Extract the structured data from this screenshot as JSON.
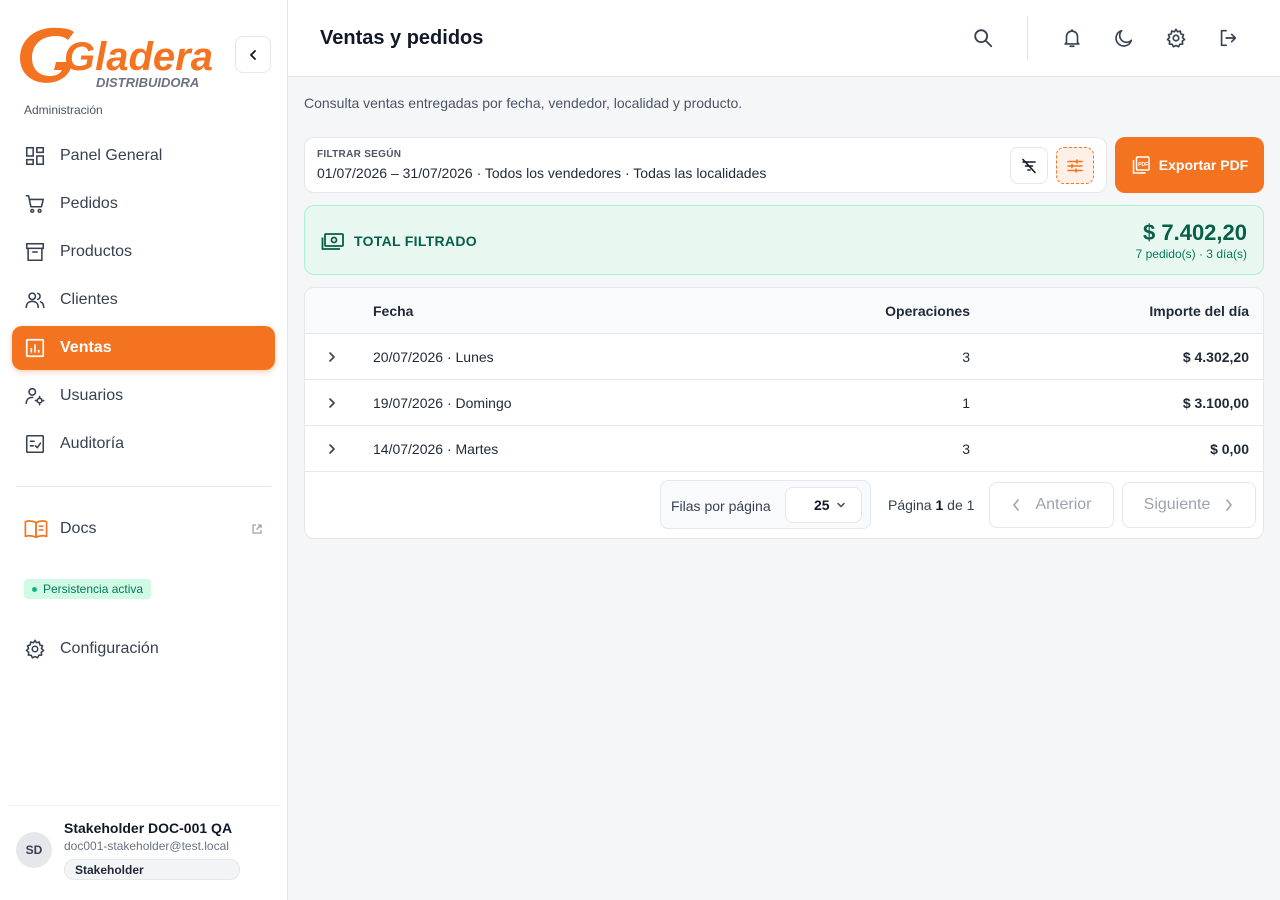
{
  "brand": {
    "name": "Gladera",
    "tagline": "DISTRIBUIDORA",
    "primary_color": "#f47320"
  },
  "sidebar": {
    "section_label": "Administración",
    "items": [
      {
        "label": "Panel General",
        "icon": "dashboard-icon"
      },
      {
        "label": "Pedidos",
        "icon": "cart-icon"
      },
      {
        "label": "Productos",
        "icon": "archive-box-icon"
      },
      {
        "label": "Clientes",
        "icon": "users-icon"
      },
      {
        "label": "Ventas",
        "icon": "chart-box-icon",
        "active": true
      },
      {
        "label": "Usuarios",
        "icon": "user-gear-icon"
      },
      {
        "label": "Auditoría",
        "icon": "checklist-icon"
      }
    ],
    "docs_label": "Docs",
    "persistence_badge": "Persistencia activa",
    "config_label": "Configuración",
    "user": {
      "initials": "SD",
      "name": "Stakeholder DOC-001 QA",
      "email": "doc001-stakeholder@test.local",
      "role": "Stakeholder"
    }
  },
  "header": {
    "title": "Ventas y pedidos",
    "icons": [
      "search-icon",
      "bell-icon",
      "moon-icon",
      "gear-icon",
      "logout-icon"
    ]
  },
  "main": {
    "subtitle": "Consulta ventas entregadas por fecha, vendedor, localidad y producto.",
    "filter": {
      "label": "FILTRAR SEGÚN",
      "value": "01/07/2026 – 31/07/2026 · Todos los vendedores · Todas las localidades"
    },
    "export_label": "Exportar PDF",
    "total": {
      "label": "TOTAL FILTRADO",
      "amount": "$ 7.402,20",
      "meta": "7 pedido(s) · 3 día(s)"
    },
    "table": {
      "columns": {
        "date": "Fecha",
        "ops": "Operaciones",
        "amount": "Importe del día"
      },
      "rows": [
        {
          "date": "20/07/2026 · Lunes",
          "ops": "3",
          "amount": "$ 4.302,20"
        },
        {
          "date": "19/07/2026 · Domingo",
          "ops": "1",
          "amount": "$ 3.100,00"
        },
        {
          "date": "14/07/2026 · Martes",
          "ops": "3",
          "amount": "$ 0,00"
        }
      ]
    },
    "pagination": {
      "rows_per_page_label": "Filas por página",
      "rows_per_page": "25",
      "page_word": "Página",
      "page_current": "1",
      "of_word": "de",
      "page_total": "1",
      "prev_label": "Anterior",
      "next_label": "Siguiente"
    }
  }
}
